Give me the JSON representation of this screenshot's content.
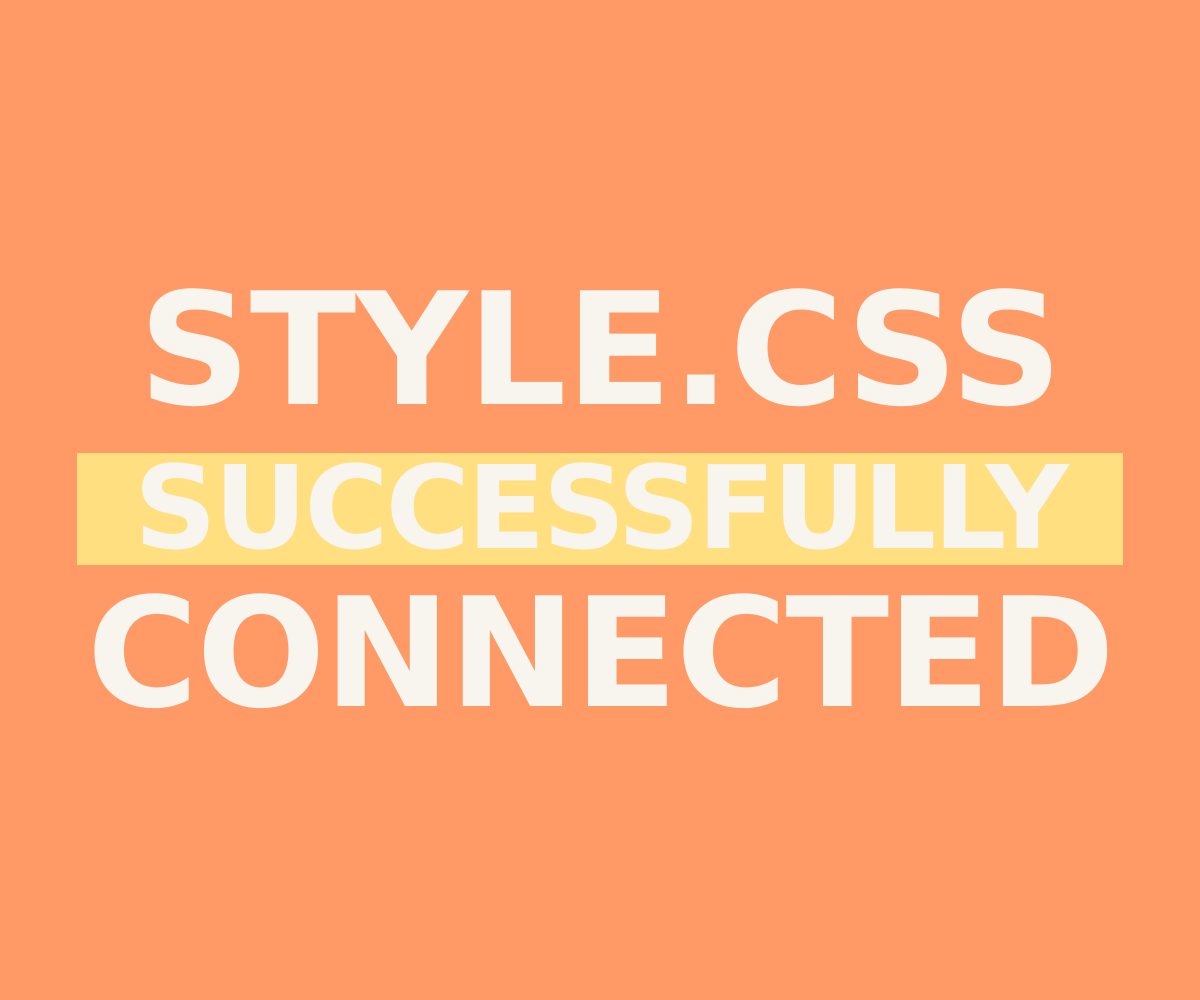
{
  "headline": {
    "line1": "STYLE.CSS",
    "line2": "SUCCESSFULLY",
    "line3": "CONNECTED"
  },
  "colors": {
    "background": "#ff9966",
    "highlight": "#ffdf80",
    "text": "#f8f5ef"
  }
}
